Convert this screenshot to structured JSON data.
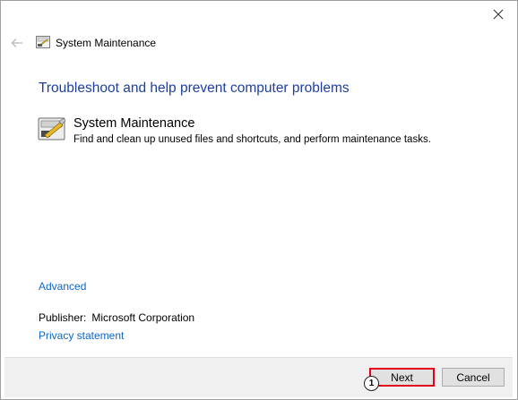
{
  "window": {
    "title": "System Maintenance",
    "close_icon": "close-icon",
    "back_icon": "back-arrow-icon"
  },
  "main": {
    "heading": "Troubleshoot and help prevent computer problems",
    "task": {
      "title": "System Maintenance",
      "description": "Find and clean up unused files and shortcuts, and perform maintenance tasks.",
      "icon": "system-maintenance-icon"
    },
    "advanced_link": "Advanced",
    "publisher_label": "Publisher:",
    "publisher_value": "Microsoft Corporation",
    "privacy_link": "Privacy statement"
  },
  "footer": {
    "next_label": "Next",
    "cancel_label": "Cancel"
  },
  "annotation": {
    "marker_label": "1",
    "highlight_color": "#e3001b"
  },
  "colors": {
    "heading": "#1e3f9e",
    "link": "#0f66c4",
    "footer_bg": "#f0f0f0"
  }
}
